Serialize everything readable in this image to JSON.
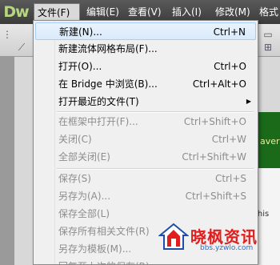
{
  "app": {
    "logo": "Dw"
  },
  "menubar": [
    {
      "label": "文件(F)",
      "active": true
    },
    {
      "label": "编辑(E)"
    },
    {
      "label": "查看(V)"
    },
    {
      "label": "插入(I)"
    },
    {
      "label": "修改(M)"
    },
    {
      "label": "格式"
    }
  ],
  "file_menu": [
    {
      "label": "新建(N)...",
      "shortcut": "Ctrl+N",
      "highlighted": true
    },
    {
      "label": "新建流体网格布局(F)..."
    },
    {
      "label": "打开(O)...",
      "shortcut": "Ctrl+O"
    },
    {
      "label": "在 Bridge 中浏览(B)...",
      "shortcut": "Ctrl+Alt+O"
    },
    {
      "label": "打开最近的文件(T)",
      "submenu": true
    },
    {
      "label": "在框架中打开(F)...",
      "shortcut": "Ctrl+Shift+O",
      "disabled": true
    },
    {
      "label": "关闭(C)",
      "shortcut": "Ctrl+W",
      "disabled": true
    },
    {
      "label": "全部关闭(E)",
      "shortcut": "Ctrl+Shift+W",
      "disabled": true
    },
    {
      "label": "保存(S)",
      "shortcut": "Ctrl+S",
      "disabled": true
    },
    {
      "label": "另存为(A)...",
      "shortcut": "Ctrl+Shift+S",
      "disabled": true
    },
    {
      "label": "保存全部(L)",
      "disabled": true
    },
    {
      "label": "保存所有相关文件(R)",
      "disabled": true
    },
    {
      "label": "另存为模板(M)...",
      "disabled": true
    },
    {
      "label": "回复至上次的保存(R)",
      "disabled": true
    }
  ],
  "background": {
    "green_text": "aver",
    "side_text": "this"
  },
  "watermark": {
    "title": "晓枫资讯",
    "subtitle": "bbs.yzwlo.com"
  }
}
